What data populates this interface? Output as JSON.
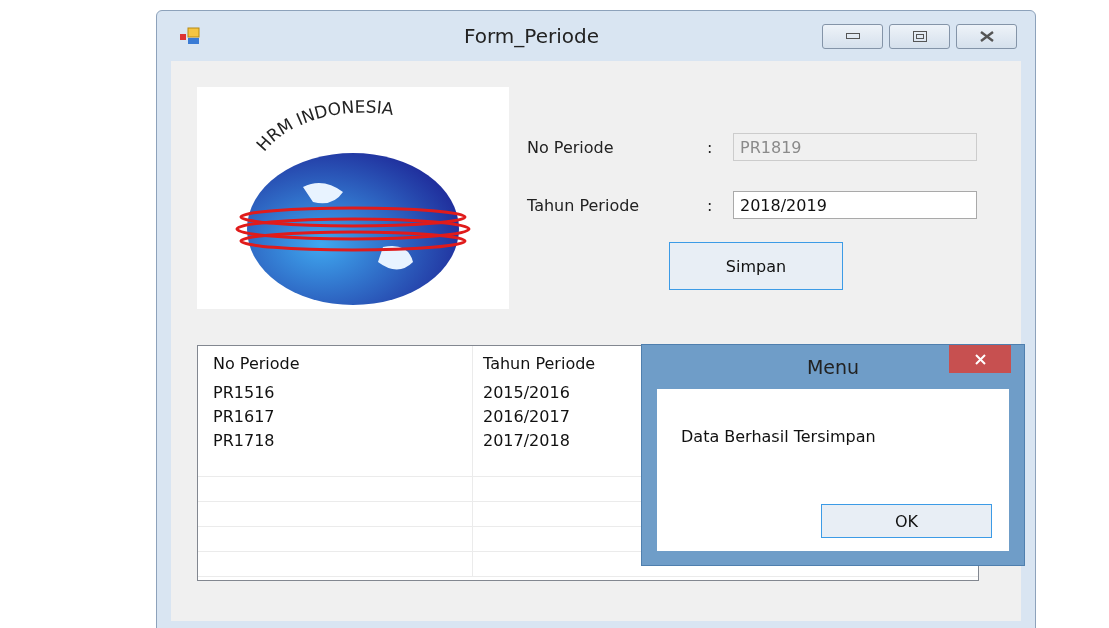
{
  "window": {
    "title": "Form_Periode"
  },
  "logo": {
    "text": "HRM INDONESIA"
  },
  "form": {
    "fields": [
      {
        "label": "No Periode",
        "separator": ":",
        "value": "PR1819",
        "disabled": true
      },
      {
        "label": "Tahun Periode",
        "separator": ":",
        "value": "2018/2019",
        "disabled": false
      }
    ],
    "button": "Simpan"
  },
  "table": {
    "columns": [
      "No Periode",
      "Tahun Periode"
    ],
    "rows": [
      [
        "PR1516",
        "2015/2016"
      ],
      [
        "PR1617",
        "2016/2017"
      ],
      [
        "PR1718",
        "2017/2018"
      ]
    ]
  },
  "dialog": {
    "title": "Menu",
    "message": "Data Berhasil Tersimpan",
    "button": "OK"
  }
}
